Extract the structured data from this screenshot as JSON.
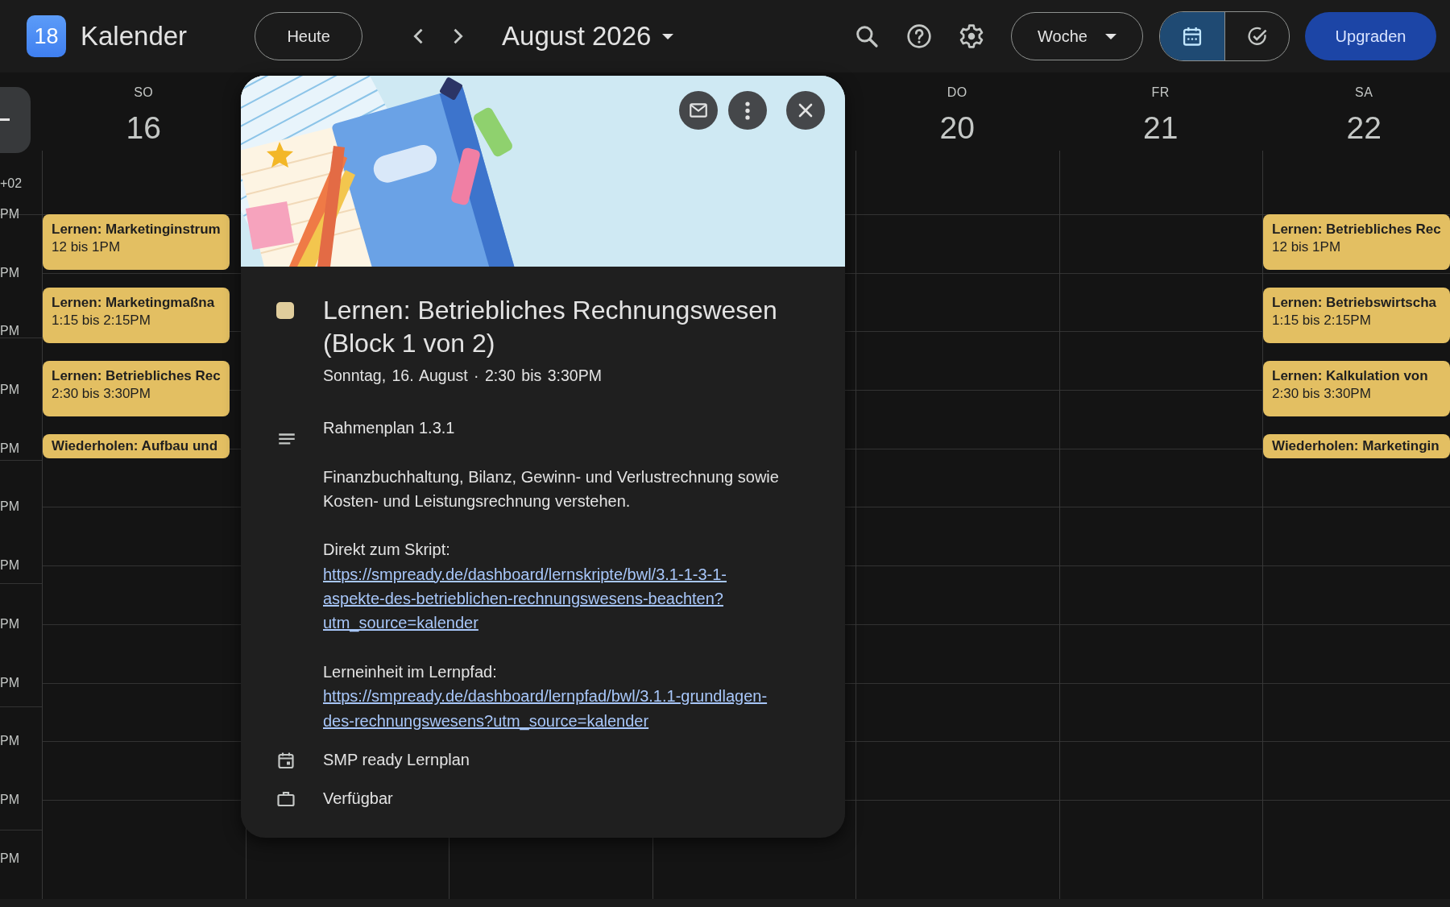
{
  "app": {
    "logo_text": "18",
    "name": "Kalender"
  },
  "toolbar": {
    "today": "Heute",
    "period": "August 2026",
    "view": "Woche",
    "view_toggle": [
      {
        "kind": "calendar",
        "selected": true
      },
      {
        "kind": "tasks",
        "selected": false
      }
    ],
    "upgrade": "Upgraden"
  },
  "timezone": "+02",
  "time_labels": [
    "PM",
    "PM",
    "PM",
    "PM",
    "PM",
    "PM",
    "PM",
    "PM",
    "PM",
    "PM",
    "PM",
    "PM"
  ],
  "days": [
    {
      "weekday": "SO",
      "date": "16",
      "events": [
        {
          "kind": "block",
          "title": "Lernen: Marketinginstrum",
          "time": "12 bis 1PM",
          "color": "#e3bf62"
        },
        {
          "kind": "block",
          "title": "Lernen: Marketingmaßna",
          "time": "1:15 bis 2:15PM",
          "color": "#e3bf62"
        },
        {
          "kind": "block",
          "title": "Lernen: Betriebliches Rec",
          "time": "2:30 bis 3:30PM",
          "color": "#e3bf62"
        },
        {
          "kind": "short",
          "title": "Wiederholen: Aufbau und",
          "color": "#e3bf62"
        }
      ]
    },
    {
      "weekday": "DO",
      "date": "20"
    },
    {
      "weekday": "FR",
      "date": "21"
    },
    {
      "weekday": "SA",
      "date": "22",
      "events": [
        {
          "kind": "block",
          "title": "Lernen: Betriebliches Rec",
          "time": "12 bis 1PM",
          "color": "#e3bf62"
        },
        {
          "kind": "block",
          "title": "Lernen: Betriebswirtscha",
          "time": "1:15 bis 2:15PM",
          "color": "#e3bf62"
        },
        {
          "kind": "block",
          "title": "Lernen: Kalkulation von",
          "time": "2:30 bis 3:30PM",
          "color": "#e3bf62"
        },
        {
          "kind": "short",
          "title": "Wiederholen: Marketingin",
          "color": "#e3bf62"
        }
      ]
    }
  ],
  "popup": {
    "color": "#e0cd9c",
    "title": "Lernen: Betriebliches Rechnungswesen (Block 1 von 2)",
    "when": "Sonntag, 16. August · 2:30 bis 3:30PM",
    "description": [
      {
        "kind": "text",
        "text": "Rahmenplan 1.3.1"
      },
      {
        "kind": "text",
        "text": "Finanzbuchhaltung, Bilanz, Gewinn- und Verlustrechnung sowie Kosten- und Leistungsrechnung verstehen."
      },
      {
        "kind": "link",
        "label": "Direkt zum Skript:",
        "url_lines": [
          "https://smpready.de/dashboard/lernskripte/bwl/3.1-1-3-1-",
          "aspekte-des-betrieblichen-rechnungswesens-beachten?",
          "utm_source=kalender"
        ]
      },
      {
        "kind": "link",
        "label": "Lerneinheit im Lernpfad:",
        "url_lines": [
          "https://smpready.de/dashboard/lernpfad/bwl/3.1.1-grundlagen-",
          "des-rechnungswesens?utm_source=kalender"
        ]
      }
    ],
    "calendar": "SMP ready Lernplan",
    "availability": "Verfügbar"
  }
}
